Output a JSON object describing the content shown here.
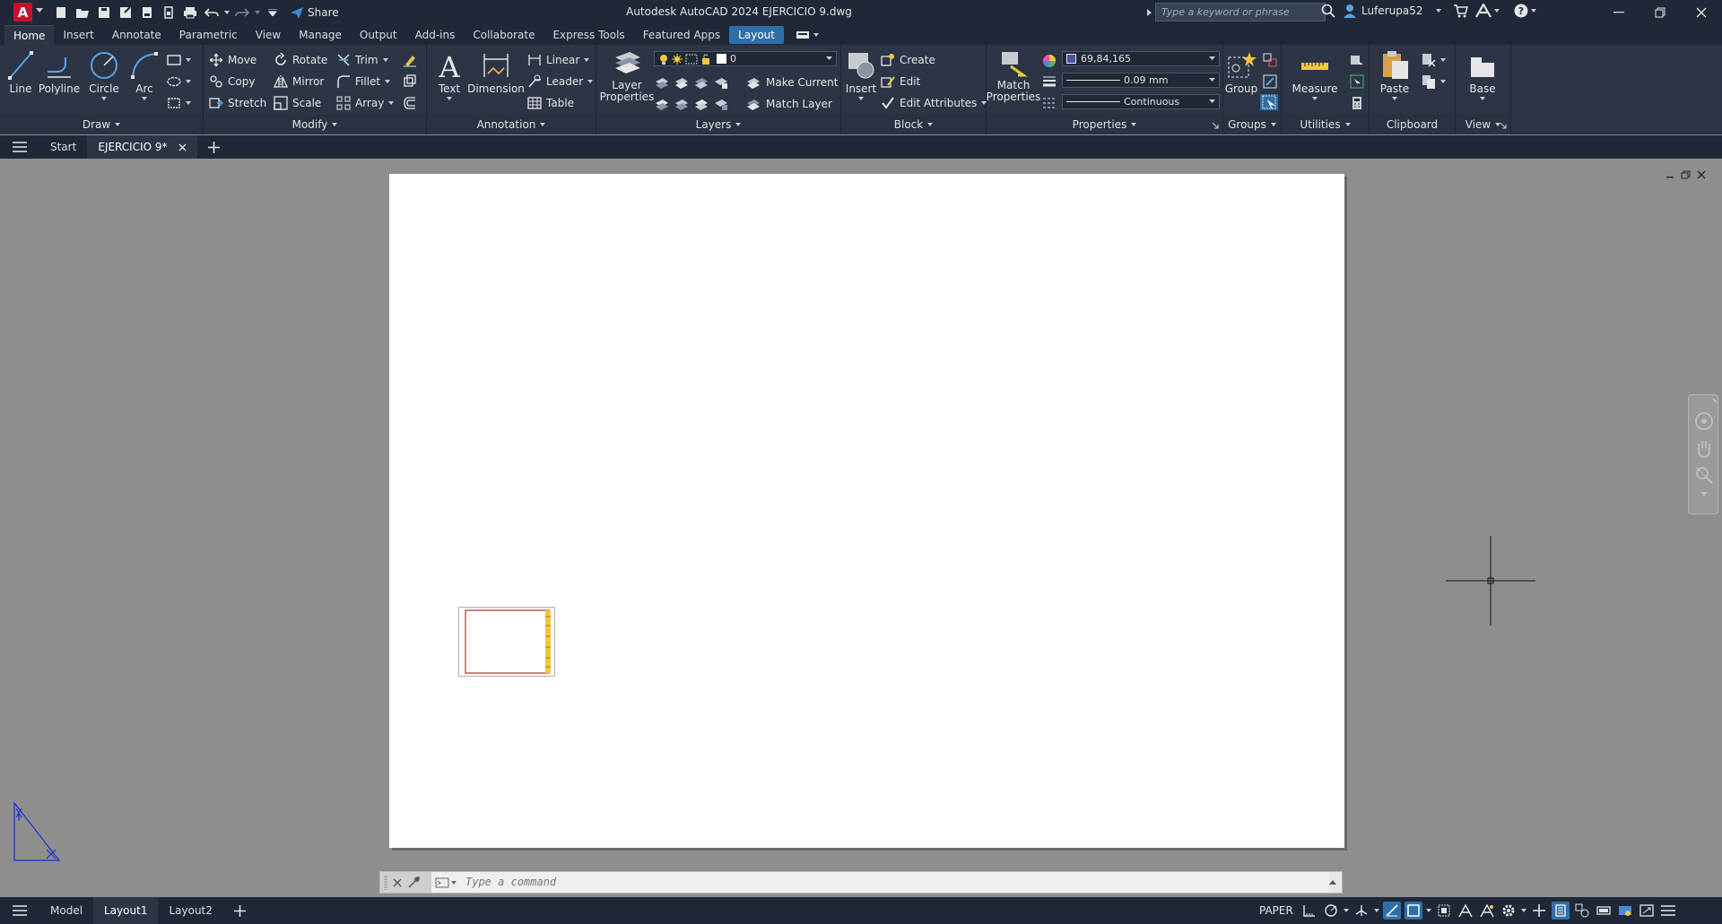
{
  "app": {
    "logo": "A",
    "title": "Autodesk AutoCAD 2024    EJERCICIO 9.dwg",
    "share_label": "Share",
    "search_placeholder": "Type a keyword or phrase",
    "user_name": "Luferupa52"
  },
  "ribbon_tabs": [
    "Home",
    "Insert",
    "Annotate",
    "Parametric",
    "View",
    "Manage",
    "Output",
    "Add-ins",
    "Collaborate",
    "Express Tools",
    "Featured Apps",
    "Layout"
  ],
  "ribbon": {
    "draw": {
      "title": "Draw",
      "line": "Line",
      "polyline": "Polyline",
      "circle": "Circle",
      "arc": "Arc"
    },
    "modify": {
      "title": "Modify",
      "move": "Move",
      "rotate": "Rotate",
      "trim": "Trim",
      "copy": "Copy",
      "mirror": "Mirror",
      "fillet": "Fillet",
      "stretch": "Stretch",
      "scale": "Scale",
      "array": "Array"
    },
    "annotation": {
      "title": "Annotation",
      "text": "Text",
      "dimension": "Dimension",
      "linear": "Linear",
      "leader": "Leader",
      "table": "Table"
    },
    "layers": {
      "title": "Layers",
      "layer_properties_1": "Layer",
      "layer_properties_2": "Properties",
      "current_layer": "0",
      "make_current": "Make Current",
      "match_layer": "Match Layer"
    },
    "block": {
      "title": "Block",
      "insert": "Insert",
      "create": "Create",
      "edit": "Edit",
      "edit_attributes": "Edit Attributes"
    },
    "properties": {
      "title": "Properties",
      "match_1": "Match",
      "match_2": "Properties",
      "color": "69,84,165",
      "lineweight": "0.09 mm",
      "linetype": "Continuous"
    },
    "groups": {
      "title": "Groups",
      "group": "Group"
    },
    "utilities": {
      "title": "Utilities",
      "measure": "Measure"
    },
    "clipboard": {
      "title": "Clipboard",
      "paste": "Paste"
    },
    "view": {
      "title": "View",
      "base": "Base"
    }
  },
  "file_tabs": {
    "start": "Start",
    "document": "EJERCICIO 9*"
  },
  "command_line": {
    "placeholder": "Type a command"
  },
  "layout_tabs": [
    "Model",
    "Layout1",
    "Layout2"
  ],
  "status": {
    "space": "PAPER"
  },
  "colors": {
    "ribbon_bg": "#2b3545",
    "titlebar_bg": "#1e2836",
    "accent": "#2e6faa",
    "logo": "#c8102e",
    "canvas_bg": "#8e8e8e",
    "layer_color_swatch": "#4554a5"
  }
}
